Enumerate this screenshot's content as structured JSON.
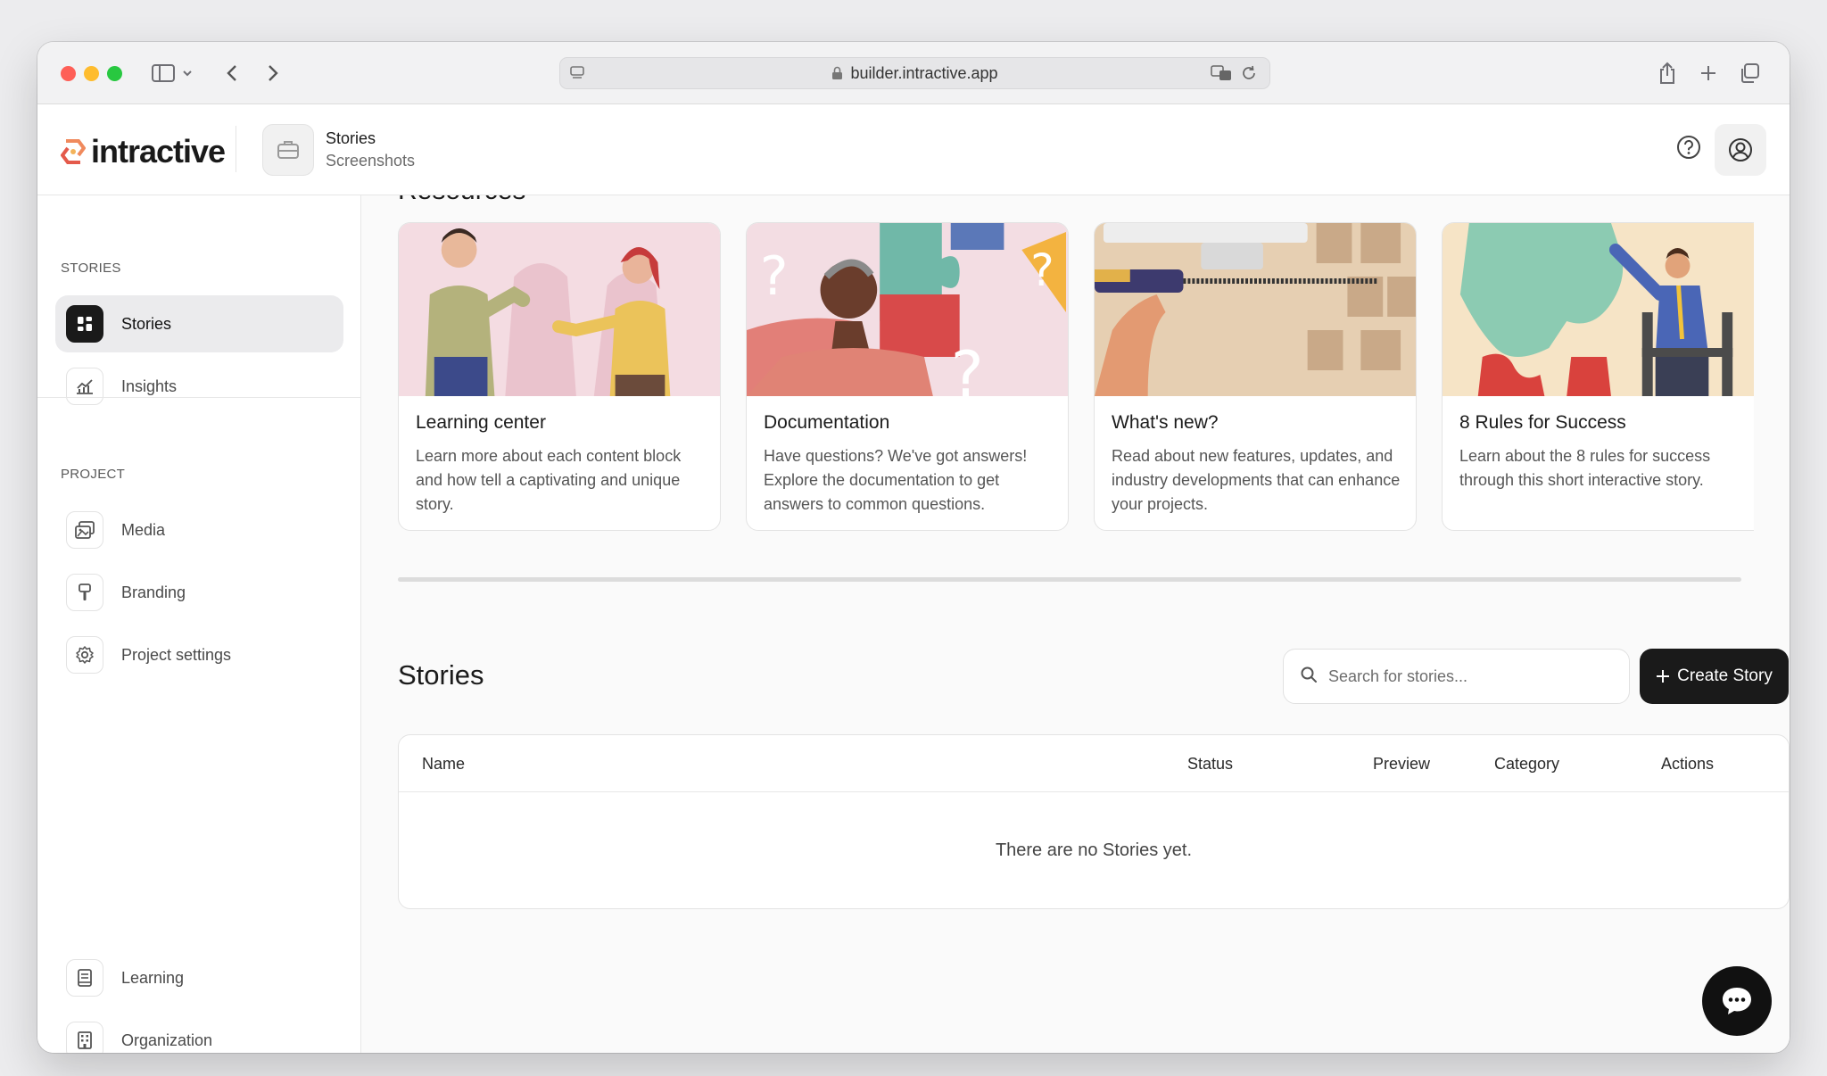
{
  "browser": {
    "url": "builder.intractive.app"
  },
  "header": {
    "logo": "intractive",
    "project_name": "Stories",
    "project_sub": "Screenshots"
  },
  "sidebar": {
    "section_stories": "STORIES",
    "section_project": "PROJECT",
    "items": [
      {
        "label": "Stories"
      },
      {
        "label": "Insights"
      },
      {
        "label": "Media"
      },
      {
        "label": "Branding"
      },
      {
        "label": "Project settings"
      },
      {
        "label": "Learning"
      },
      {
        "label": "Organization"
      }
    ]
  },
  "resources": {
    "title": "Resources",
    "cards": [
      {
        "title": "Learning center",
        "desc": "Learn more about each content block and how tell a captivating and unique story."
      },
      {
        "title": "Documentation",
        "desc": "Have questions? We've got answers! Explore the documentation to get answers to common questions."
      },
      {
        "title": "What's new?",
        "desc": "Read about new features, updates, and industry developments that can enhance your projects."
      },
      {
        "title": "8 Rules for Success",
        "desc": "Learn about the 8 rules for success through this short interactive story."
      }
    ]
  },
  "stories": {
    "title": "Stories",
    "search_placeholder": "Search for stories...",
    "create_label": "Create Story",
    "columns": [
      "Name",
      "Status",
      "Preview",
      "Category",
      "Actions"
    ],
    "empty_text": "There are no Stories yet."
  }
}
